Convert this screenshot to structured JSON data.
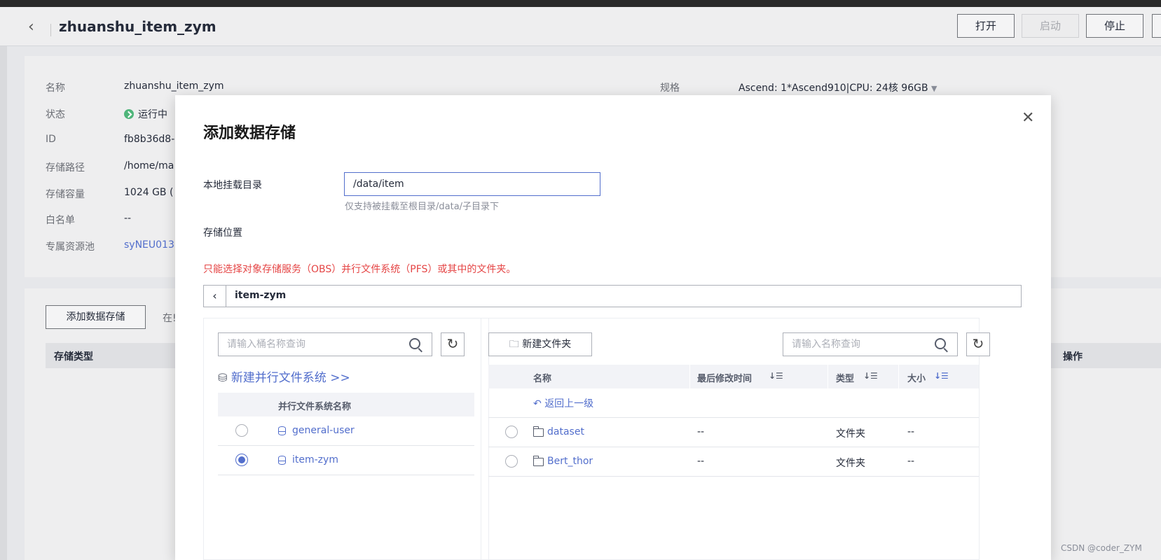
{
  "header": {
    "title": "zhuanshu_item_zym",
    "buttons": {
      "open": "打开",
      "start": "启动",
      "stop": "停止"
    }
  },
  "info": {
    "rows": [
      {
        "label": "名称",
        "value": "zhuanshu_item_zym"
      },
      {
        "label": "状态",
        "value": "运行中"
      },
      {
        "label": "ID",
        "value": "fb8b36d8-("
      },
      {
        "label": "存储路径",
        "value": "/home/ma"
      },
      {
        "label": "存储容量",
        "value": "1024 GB ("
      },
      {
        "label": "白名单",
        "value": "--"
      },
      {
        "label": "专属资源池",
        "value": "syNEU013"
      }
    ],
    "spec_label": "规格",
    "spec_value": "Ascend: 1*Ascend910|CPU: 24核 96GB"
  },
  "storage_section": {
    "add_button": "添加数据存储",
    "partial_text": "在!",
    "col_type": "存储类型",
    "col_ops": "操作"
  },
  "modal": {
    "title": "添加数据存储",
    "mount_label": "本地挂载目录",
    "mount_value": "/data/item",
    "mount_hint": "仅支持被挂载至根目录/data/子目录下",
    "location_label": "存储位置",
    "warning": "只能选择对象存储服务（OBS）并行文件系统（PFS）或其中的文件夹。",
    "path": "item-zym",
    "left": {
      "search_placeholder": "请输入桶名称查询",
      "create_link": "新建并行文件系统 >>",
      "col_name": "并行文件系统名称",
      "rows": [
        {
          "name": "general-user",
          "selected": false
        },
        {
          "name": "item-zym",
          "selected": true
        }
      ]
    },
    "right": {
      "new_folder": "新建文件夹",
      "search_placeholder": "请输入名称查询",
      "cols": {
        "name": "名称",
        "modified": "最后修改时间",
        "type": "类型",
        "size": "大小"
      },
      "back": "返回上一级",
      "rows": [
        {
          "name": "dataset",
          "modified": "--",
          "type": "文件夹",
          "size": "--"
        },
        {
          "name": "Bert_thor",
          "modified": "--",
          "type": "文件夹",
          "size": "--"
        }
      ]
    }
  },
  "watermark": "CSDN @coder_ZYM",
  "colors": {
    "accent": "#526ecc",
    "warning": "#e54545",
    "success": "#4fb57a"
  }
}
